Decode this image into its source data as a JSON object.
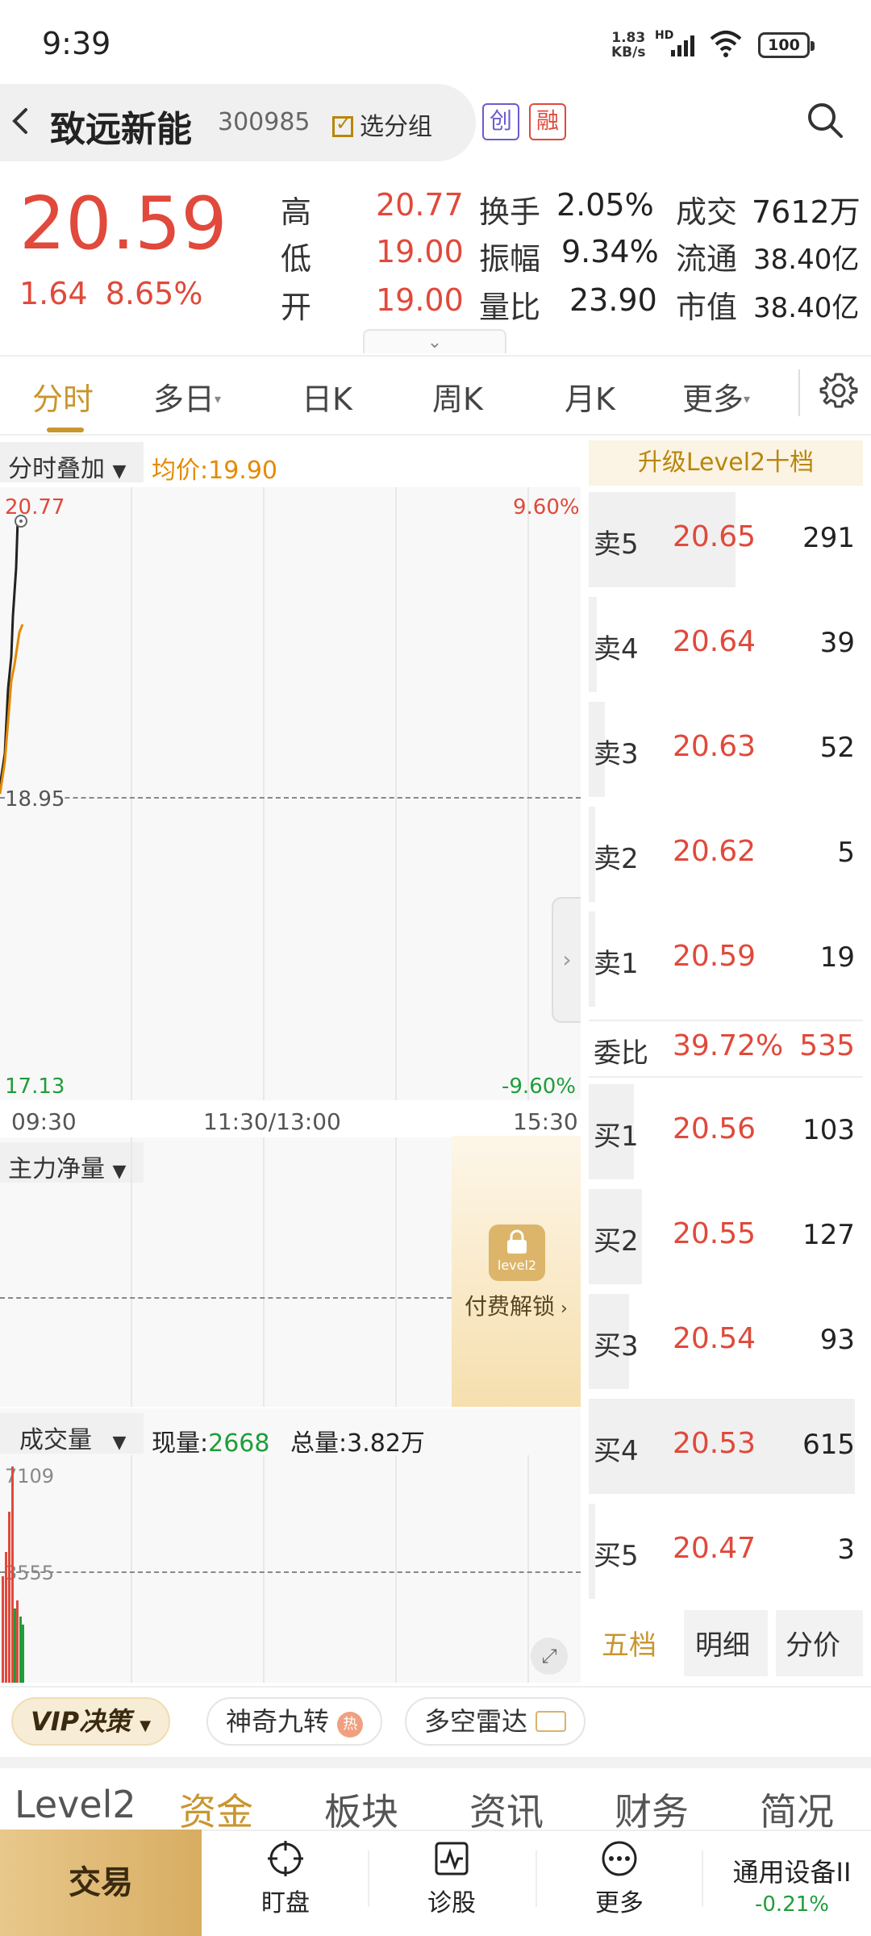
{
  "status_bar": {
    "time": "9:39",
    "net_speed_value": "1.83",
    "net_speed_unit": "KB/s",
    "network": "HD",
    "battery": "100"
  },
  "header": {
    "stock_name": "致远新能",
    "stock_code": "300985",
    "group_button": "选分组",
    "tags": [
      "创",
      "融"
    ]
  },
  "quote": {
    "price": "20.59",
    "change": "1.64",
    "change_pct": "8.65%",
    "high_label": "高",
    "high": "20.77",
    "low_label": "低",
    "low": "19.00",
    "open_label": "开",
    "open": "19.00",
    "turnover_label": "换手",
    "turnover": "2.05%",
    "amplitude_label": "振幅",
    "amplitude": "9.34%",
    "volume_ratio_label": "量比",
    "volume_ratio": "23.90",
    "deal_label": "成交",
    "deal": "7612万",
    "float_label": "流通",
    "float": "38.40亿",
    "mktcap_label": "市值",
    "mktcap": "38.40亿"
  },
  "tabs": [
    {
      "label": "分时",
      "active": true
    },
    {
      "label": "多日",
      "dropdown": true
    },
    {
      "label": "日K"
    },
    {
      "label": "周K"
    },
    {
      "label": "月K"
    },
    {
      "label": "更多",
      "dropdown": true
    }
  ],
  "intraday": {
    "overlay_label": "分时叠加",
    "avg_label": "均价:19.90",
    "top_price": "20.77",
    "top_pct": "9.60%",
    "mid_price": "18.95",
    "bottom_price": "17.13",
    "bottom_pct": "-9.60%",
    "time_start": "09:30",
    "time_mid": "11:30/13:00",
    "time_end": "15:30"
  },
  "main_force": {
    "label": "主力净量",
    "lock_badge": "level2",
    "unlock_text": "付费解锁"
  },
  "volume": {
    "label": "成交量",
    "current_label": "现量:",
    "current_value": "2668",
    "total_label": "总量:3.82万",
    "top_value": "7109",
    "mid_value": "3555"
  },
  "order_book": {
    "upgrade_label": "升级Level2十档",
    "asks": [
      {
        "side": "卖5",
        "price": "20.65",
        "vol": "291",
        "bar": 0.55
      },
      {
        "side": "卖4",
        "price": "20.64",
        "vol": "39",
        "bar": 0.03
      },
      {
        "side": "卖3",
        "price": "20.63",
        "vol": "52",
        "bar": 0.06
      },
      {
        "side": "卖2",
        "price": "20.62",
        "vol": "5",
        "bar": 0.01
      },
      {
        "side": "卖1",
        "price": "20.59",
        "vol": "19",
        "bar": 0.02
      }
    ],
    "ratio_label": "委比",
    "ratio_pct": "39.72%",
    "ratio_val": "535",
    "bids": [
      {
        "side": "买1",
        "price": "20.56",
        "vol": "103",
        "bar": 0.17
      },
      {
        "side": "买2",
        "price": "20.55",
        "vol": "127",
        "bar": 0.2
      },
      {
        "side": "买3",
        "price": "20.54",
        "vol": "93",
        "bar": 0.15
      },
      {
        "side": "买4",
        "price": "20.53",
        "vol": "615",
        "bar": 1.0
      },
      {
        "side": "买5",
        "price": "20.47",
        "vol": "3",
        "bar": 0.005
      }
    ],
    "bottom_tabs": [
      "五档",
      "明细",
      "分价"
    ]
  },
  "chips": {
    "vip": "VIP决策",
    "magic": "神奇九转",
    "magic_badge": "热",
    "radar": "多空雷达"
  },
  "section_tabs": [
    "Level2",
    "资金",
    "板块",
    "资讯",
    "财务",
    "简况"
  ],
  "bottom_nav": {
    "trade": "交易",
    "items": [
      {
        "label": "盯盘",
        "icon": "crosshair-icon"
      },
      {
        "label": "诊股",
        "icon": "pulse-chart-icon"
      },
      {
        "label": "更多",
        "icon": "more-dots-icon"
      }
    ],
    "sector_name": "通用设备II",
    "sector_change": "-0.21%"
  },
  "colors": {
    "up": "#e0493b",
    "down": "#1f9d3a",
    "accent_gold": "#c9962f"
  }
}
